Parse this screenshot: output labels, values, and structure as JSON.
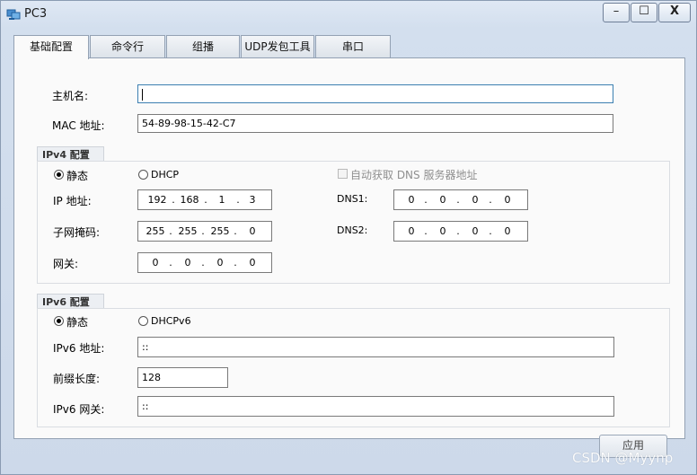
{
  "window": {
    "title": "PC3",
    "min": "–",
    "max": "☐",
    "close": "X"
  },
  "tabs": [
    "基础配置",
    "命令行",
    "组播",
    "UDP发包工具",
    "串口"
  ],
  "basic": {
    "hostname_label": "主机名:",
    "hostname_value": "",
    "mac_label": "MAC 地址:",
    "mac_value": "54-89-98-15-42-C7"
  },
  "ipv4": {
    "group_title": "IPv4 配置",
    "static_label": "静态",
    "dhcp_label": "DHCP",
    "auto_dns_label": "自动获取 DNS 服务器地址",
    "ip_label": "IP 地址:",
    "ip": [
      "192",
      "168",
      "1",
      "3"
    ],
    "mask_label": "子网掩码:",
    "mask": [
      "255",
      "255",
      "255",
      "0"
    ],
    "gw_label": "网关:",
    "gw": [
      "0",
      "0",
      "0",
      "0"
    ],
    "dns1_label": "DNS1:",
    "dns1": [
      "0",
      "0",
      "0",
      "0"
    ],
    "dns2_label": "DNS2:",
    "dns2": [
      "0",
      "0",
      "0",
      "0"
    ]
  },
  "ipv6": {
    "group_title": "IPv6 配置",
    "static_label": "静态",
    "dhcp_label": "DHCPv6",
    "ip_label": "IPv6 地址:",
    "ip_value": "::",
    "prefix_label": "前缀长度:",
    "prefix_value": "128",
    "gw_label": "IPv6 网关:",
    "gw_value": "::"
  },
  "apply_label": "应用",
  "watermark": "CSDN @Myynp"
}
